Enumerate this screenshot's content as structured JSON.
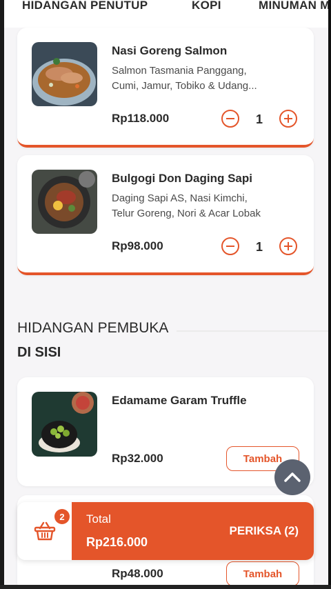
{
  "tabs": [
    "HIDANGAN PENUTUP",
    "KOPI",
    "MINUMAN M"
  ],
  "items": [
    {
      "name": "Nasi Goreng Salmon",
      "desc1": "Salmon Tasmania Panggang,",
      "desc2": "Cumi, Jamur, Tobiko & Udang...",
      "price": "Rp118.000",
      "qty": "1"
    },
    {
      "name": "Bulgogi Don Daging Sapi",
      "desc1": "Daging Sapi AS, Nasi Kimchi,",
      "desc2": "Telur Goreng, Nori & Acar Lobak",
      "price": "Rp98.000",
      "qty": "1"
    },
    {
      "name": "Edamame Garam Truffle",
      "price": "Rp32.000",
      "add_label": "Tambah"
    },
    {
      "price": "Rp48.000",
      "add_label": "Tambah"
    }
  ],
  "section": {
    "title": "HIDANGAN PEMBUKA",
    "subtitle": "DI SISI"
  },
  "icons": {
    "minus": "minus-circle-icon",
    "plus": "plus-circle-icon",
    "scroll_top": "chevron-up-icon",
    "cart": "basket-icon"
  },
  "cart": {
    "badge": "2",
    "total_label": "Total",
    "total_value": "Rp216.000",
    "checkout_label": "PERIKSA (2)"
  },
  "colors": {
    "accent": "#e4552a",
    "background": "#f6f5f7",
    "scroll_button": "#5b6270"
  }
}
